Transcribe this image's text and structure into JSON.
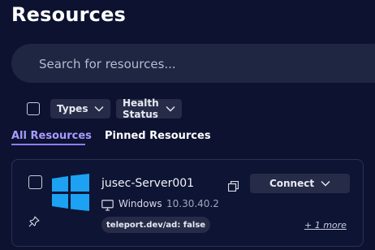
{
  "page": {
    "title": "Resources"
  },
  "search": {
    "placeholder": "Search for resources..."
  },
  "filters": {
    "types_label": "Types",
    "health_label": "Health Status"
  },
  "tabs": [
    {
      "label": "All Resources",
      "active": true
    },
    {
      "label": "Pinned Resources",
      "active": false
    }
  ],
  "resource": {
    "name": "jusec-Server001",
    "connect_label": "Connect",
    "os": "Windows",
    "address": "10.30.40.2",
    "label": "teleport.dev/ad: false",
    "more_link": "+ 1 more",
    "logo": "windows-logo"
  },
  "colors": {
    "background": "#0c1230",
    "accent": "#8e7dff",
    "windows_blue": "#1da1f2"
  }
}
